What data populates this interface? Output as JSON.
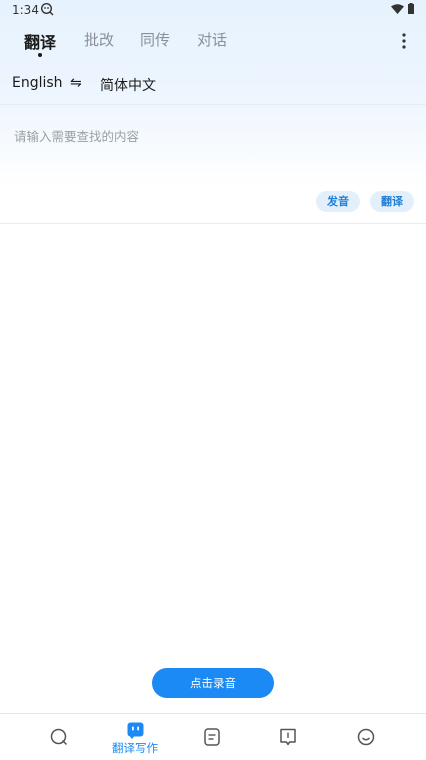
{
  "status": {
    "time": "1:34"
  },
  "tabs": [
    {
      "label": "翻译",
      "active": true
    },
    {
      "label": "批改",
      "active": false
    },
    {
      "label": "同传",
      "active": false
    },
    {
      "label": "对话",
      "active": false
    }
  ],
  "language": {
    "source": "English",
    "swap_icon": "⇋",
    "target": "简体中文"
  },
  "input": {
    "placeholder": "请输入需要查找的内容",
    "value": ""
  },
  "actions": {
    "speak_label": "发音",
    "translate_label": "翻译"
  },
  "record": {
    "label": "点击录音"
  },
  "bottom_nav": {
    "items": [
      {
        "icon": "search-chat-icon",
        "label": ""
      },
      {
        "icon": "translate-robot-icon",
        "label": "翻译写作",
        "active": true
      },
      {
        "icon": "document-icon",
        "label": ""
      },
      {
        "icon": "book-icon",
        "label": ""
      },
      {
        "icon": "smiley-icon",
        "label": ""
      }
    ]
  },
  "colors": {
    "accent": "#1b8af5",
    "pill_bg": "#e3f0fc",
    "header_bg": "#e6f2fd"
  }
}
